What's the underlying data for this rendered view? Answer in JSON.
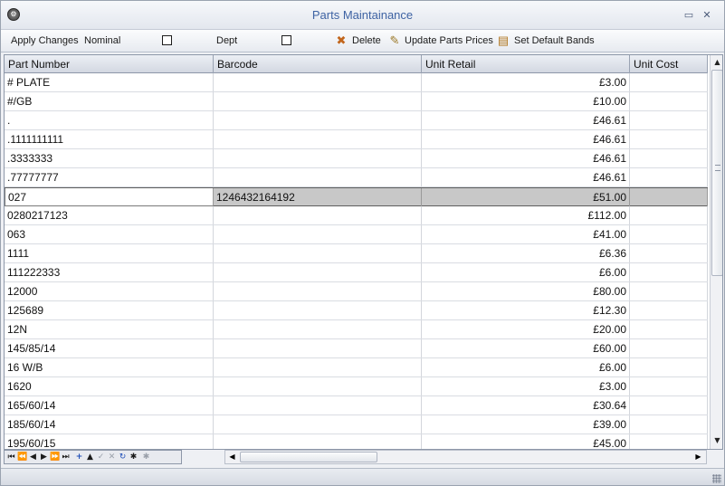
{
  "window": {
    "title": "Parts Maintainance",
    "app_icon": "gear-icon"
  },
  "toolbar": {
    "apply_changes": "Apply Changes",
    "nominal_label": "Nominal",
    "dept_label": "Dept",
    "delete_label": "Delete",
    "update_prices_label": "Update Parts Prices",
    "set_default_bands_label": "Set Default Bands"
  },
  "grid": {
    "columns": [
      "Part Number",
      "Barcode",
      "Unit Retail",
      "Unit Cost"
    ],
    "rows": [
      {
        "part": "# PLATE",
        "barcode": "",
        "retail": "£3.00"
      },
      {
        "part": "#/GB",
        "barcode": "",
        "retail": "£10.00"
      },
      {
        "part": ".",
        "barcode": "",
        "retail": "£46.61"
      },
      {
        "part": ".1111111111",
        "barcode": "",
        "retail": "£46.61"
      },
      {
        "part": ".3333333",
        "barcode": "",
        "retail": "£46.61"
      },
      {
        "part": ".77777777",
        "barcode": "",
        "retail": "£46.61"
      },
      {
        "part": "027",
        "barcode": "1246432164192",
        "retail": "£51.00"
      },
      {
        "part": "0280217123",
        "barcode": "",
        "retail": "£112.00"
      },
      {
        "part": "063",
        "barcode": "",
        "retail": "£41.00"
      },
      {
        "part": "1111",
        "barcode": "",
        "retail": "£6.36"
      },
      {
        "part": "111222333",
        "barcode": "",
        "retail": "£6.00"
      },
      {
        "part": "12000",
        "barcode": "",
        "retail": "£80.00"
      },
      {
        "part": "125689",
        "barcode": "",
        "retail": "£12.30"
      },
      {
        "part": "12N",
        "barcode": "",
        "retail": "£20.00"
      },
      {
        "part": "145/85/14",
        "barcode": "",
        "retail": "£60.00"
      },
      {
        "part": "16 W/B",
        "barcode": "",
        "retail": "£6.00"
      },
      {
        "part": "1620",
        "barcode": "",
        "retail": "£3.00"
      },
      {
        "part": "165/60/14",
        "barcode": "",
        "retail": "£30.64"
      },
      {
        "part": "185/60/14",
        "barcode": "",
        "retail": "£39.00"
      },
      {
        "part": "195/60/15",
        "barcode": "",
        "retail": "£45.00"
      }
    ],
    "selected_row": 6
  },
  "colors": {
    "title_text": "#3e63a3",
    "selected_row": "#c8c8c8"
  }
}
